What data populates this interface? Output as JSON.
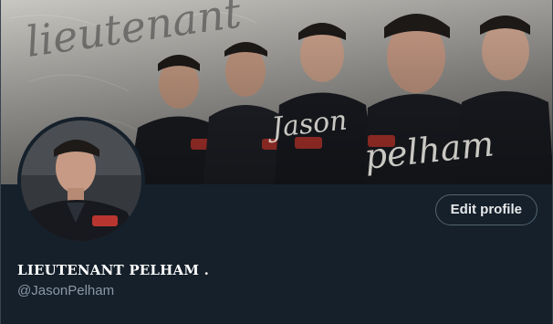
{
  "profile": {
    "display_name": "LIEUTENANT PELHAM .",
    "handle": "@JasonPelham",
    "edit_button_label": "Edit profile"
  },
  "banner": {
    "script_text_top": "lieutenant",
    "script_text_name_1": "Jason",
    "script_text_name_2": "pelham"
  },
  "colors": {
    "background": "#15202b",
    "text_primary": "#ffffff",
    "text_secondary": "#8b98a5",
    "button_border": "#536471"
  }
}
